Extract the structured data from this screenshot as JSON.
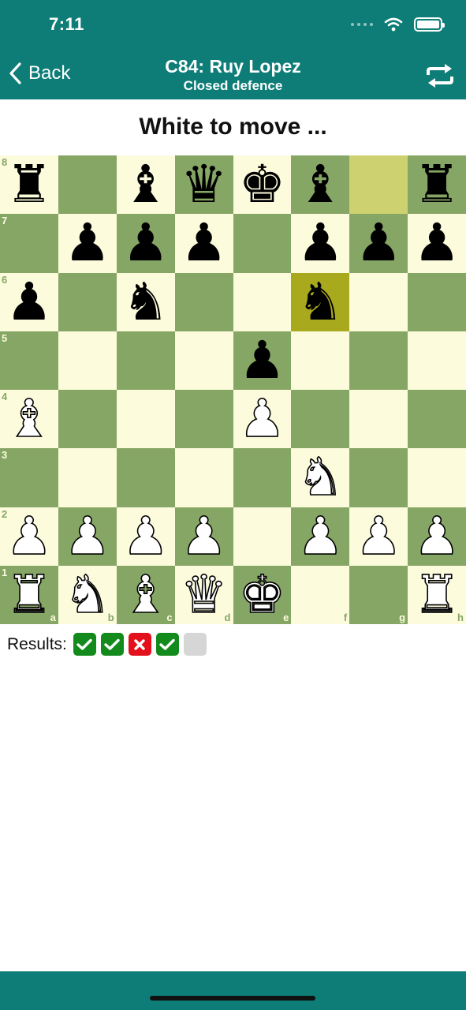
{
  "status_bar": {
    "time": "7:11"
  },
  "nav": {
    "back_label": "Back",
    "title": "C84: Ruy Lopez",
    "subtitle": "Closed defence",
    "flip_icon": "flip-board-icon"
  },
  "prompt": "White to move ...",
  "board": {
    "files": [
      "a",
      "b",
      "c",
      "d",
      "e",
      "f",
      "g",
      "h"
    ],
    "ranks": [
      "8",
      "7",
      "6",
      "5",
      "4",
      "3",
      "2",
      "1"
    ],
    "highlight_from": "g8",
    "highlight_to": "f6",
    "pieces": {
      "a8": "r",
      "c8": "b",
      "d8": "q",
      "e8": "k",
      "f8": "b",
      "h8": "r",
      "b7": "p",
      "c7": "p",
      "d7": "p",
      "f7": "p",
      "g7": "p",
      "h7": "p",
      "a6": "p",
      "c6": "n",
      "f6": "n",
      "e5": "p",
      "a4": "B",
      "e4": "P",
      "f3": "N",
      "a2": "P",
      "b2": "P",
      "c2": "P",
      "d2": "P",
      "f2": "P",
      "g2": "P",
      "h2": "P",
      "a1": "R",
      "b1": "N",
      "c1": "B",
      "d1": "Q",
      "e1": "K",
      "h1": "R"
    }
  },
  "results": {
    "label": "Results:",
    "items": [
      "correct",
      "correct",
      "wrong",
      "correct",
      "pending"
    ],
    "colors": {
      "correct": "#138a1c",
      "wrong": "#e3111b",
      "pending": "#d6d6d6"
    }
  },
  "colors": {
    "accent": "#0e7d77",
    "light_square": "#fcfbdc",
    "dark_square": "#86a665",
    "from_square": "#cdd16f",
    "to_square": "#a9a91d"
  }
}
